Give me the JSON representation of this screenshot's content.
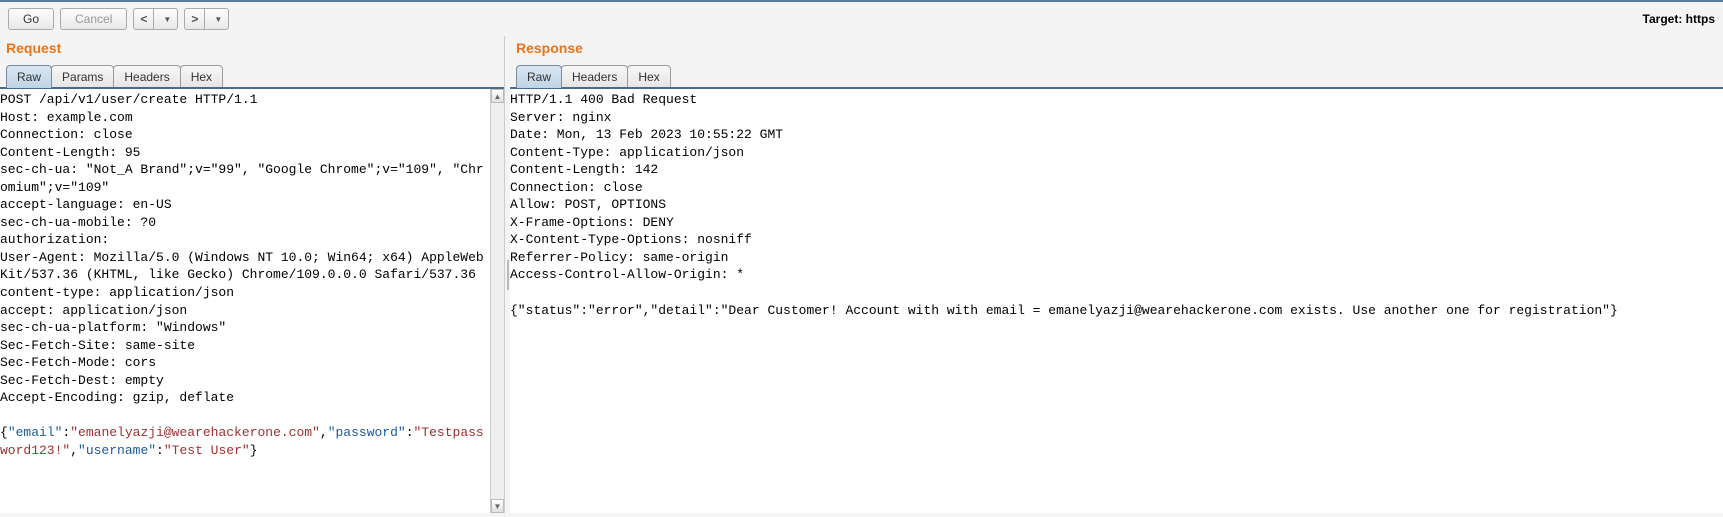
{
  "toolbar": {
    "go_label": "Go",
    "cancel_label": "Cancel",
    "target_label": "Target: https"
  },
  "request": {
    "title": "Request",
    "tabs": [
      "Raw",
      "Params",
      "Headers",
      "Hex"
    ],
    "active_tab": "Raw",
    "headers_text": "POST /api/v1/user/create HTTP/1.1\nHost: example.com\nConnection: close\nContent-Length: 95\nsec-ch-ua: \"Not_A Brand\";v=\"99\", \"Google Chrome\";v=\"109\", \"Chromium\";v=\"109\"\naccept-language: en-US\nsec-ch-ua-mobile: ?0\nauthorization:\nUser-Agent: Mozilla/5.0 (Windows NT 10.0; Win64; x64) AppleWebKit/537.36 (KHTML, like Gecko) Chrome/109.0.0.0 Safari/537.36\ncontent-type: application/json\naccept: application/json\nsec-ch-ua-platform: \"Windows\"\nSec-Fetch-Site: same-site\nSec-Fetch-Mode: cors\nSec-Fetch-Dest: empty\nAccept-Encoding: gzip, deflate\n",
    "body": {
      "email_key": "\"email\"",
      "email_val": "\"emanelyazji@wearehackerone.com\"",
      "password_key": "\"password\"",
      "password_val": "\"Testpassword123!\"",
      "username_key": "\"username\"",
      "username_val": "\"Test User\""
    }
  },
  "response": {
    "title": "Response",
    "tabs": [
      "Raw",
      "Headers",
      "Hex"
    ],
    "active_tab": "Raw",
    "text": "HTTP/1.1 400 Bad Request\nServer: nginx\nDate: Mon, 13 Feb 2023 10:55:22 GMT\nContent-Type: application/json\nContent-Length: 142\nConnection: close\nAllow: POST, OPTIONS\nX-Frame-Options: DENY\nX-Content-Type-Options: nosniff\nReferrer-Policy: same-origin\nAccess-Control-Allow-Origin: *\n\n{\"status\":\"error\",\"detail\":\"Dear Customer! Account with with email = emanelyazji@wearehackerone.com exists. Use another one for registration\"}"
  }
}
